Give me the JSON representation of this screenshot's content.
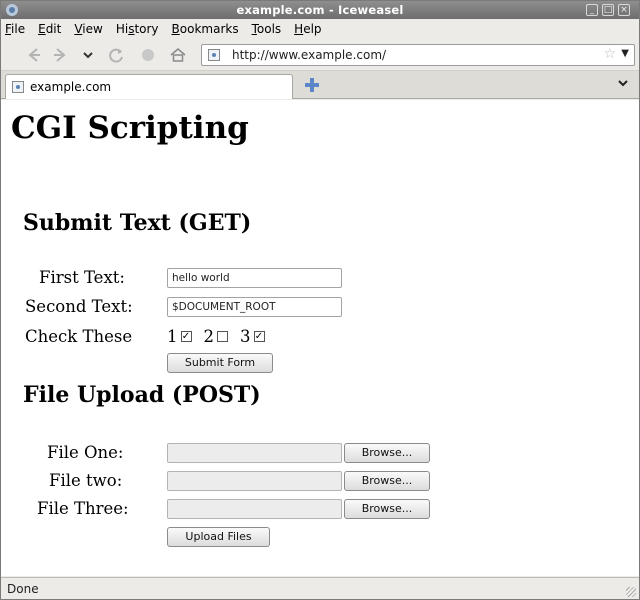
{
  "window": {
    "title": "example.com - Iceweasel"
  },
  "menu": [
    {
      "pre": "",
      "ul": "F",
      "post": "ile"
    },
    {
      "pre": "",
      "ul": "E",
      "post": "dit"
    },
    {
      "pre": "",
      "ul": "V",
      "post": "iew"
    },
    {
      "pre": "Hi",
      "ul": "s",
      "post": "tory"
    },
    {
      "pre": "",
      "ul": "B",
      "post": "ookmarks"
    },
    {
      "pre": "",
      "ul": "T",
      "post": "ools"
    },
    {
      "pre": "",
      "ul": "H",
      "post": "elp"
    }
  ],
  "toolbar": {
    "url": "http://www.example.com/",
    "icons": [
      "back-icon",
      "forward-icon",
      "history-dropdown-icon",
      "reload-icon",
      "stop-icon",
      "home-icon"
    ]
  },
  "tabs": [
    {
      "label": "example.com"
    }
  ],
  "page": {
    "title": "CGI Scripting",
    "get_section": {
      "heading": "Submit Text (GET)",
      "first_label": "First Text:",
      "first_value": "hello world",
      "second_label": "Second Text:",
      "second_value": "$DOCUMENT_ROOT",
      "check_label": "Check These",
      "checks": [
        {
          "label": "1",
          "checked": true
        },
        {
          "label": "2",
          "checked": false
        },
        {
          "label": "3",
          "checked": true
        }
      ],
      "submit_label": "Submit Form"
    },
    "post_section": {
      "heading": "File Upload (POST)",
      "files": [
        {
          "label": "File One:",
          "button": "Browse..."
        },
        {
          "label": "File two:",
          "button": "Browse..."
        },
        {
          "label": "File Three:",
          "button": "Browse..."
        }
      ],
      "upload_label": "Upload Files"
    }
  },
  "status": {
    "text": "Done"
  }
}
